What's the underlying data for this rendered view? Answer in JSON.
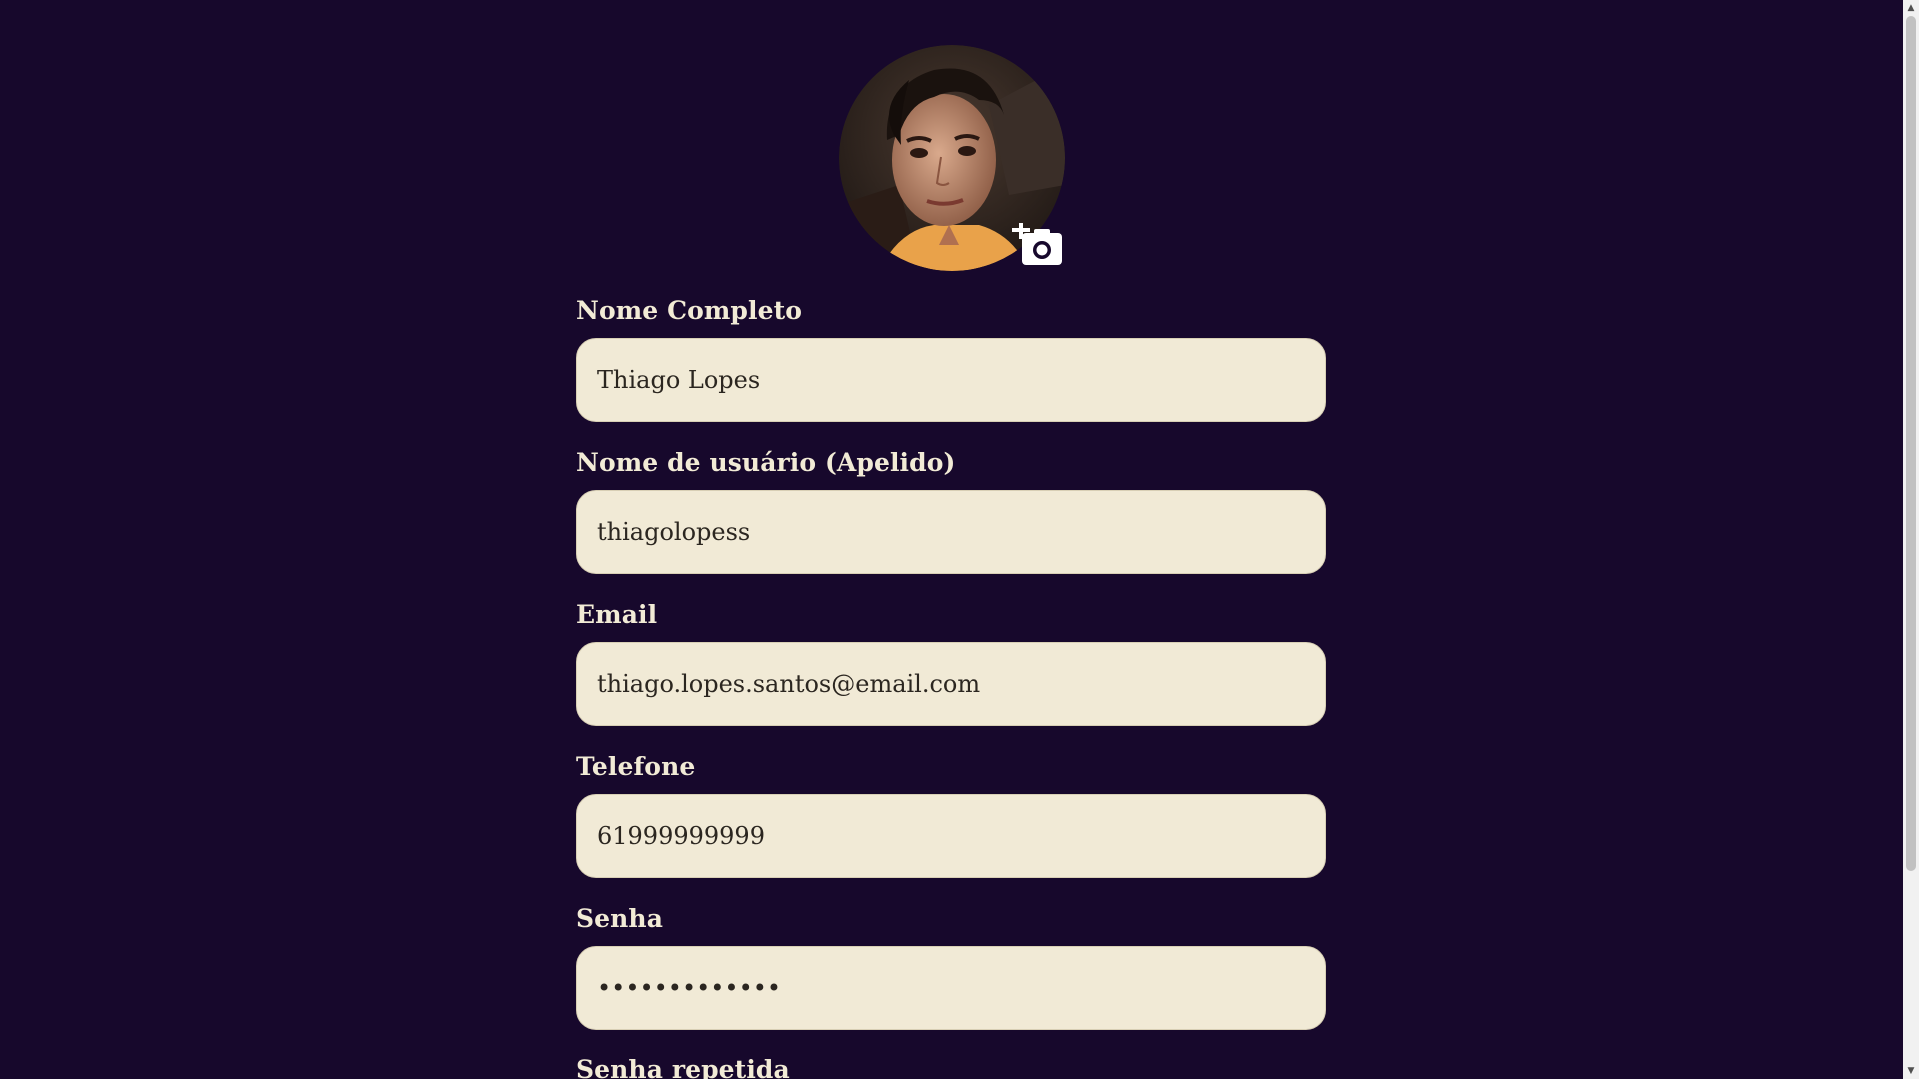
{
  "profile": {
    "avatar_alt": "Foto de perfil",
    "add_photo_icon": "add-photo-camera-icon"
  },
  "fields": [
    {
      "label": "Nome Completo",
      "value": "Thiago Lopes",
      "type": "text"
    },
    {
      "label": "Nome de usuário (Apelido)",
      "value": "thiagolopess",
      "type": "text"
    },
    {
      "label": "Email",
      "value": "thiago.lopes.santos@email.com",
      "type": "email"
    },
    {
      "label": "Telefone",
      "value": "61999999999",
      "type": "tel"
    },
    {
      "label": "Senha",
      "value": "•••••••••••••",
      "type": "password"
    },
    {
      "label": "Senha repetida",
      "value": "",
      "type": "password"
    }
  ],
  "colors": {
    "background": "#17082c",
    "label": "#f2ebd6",
    "input_background": "#f1ead6"
  }
}
